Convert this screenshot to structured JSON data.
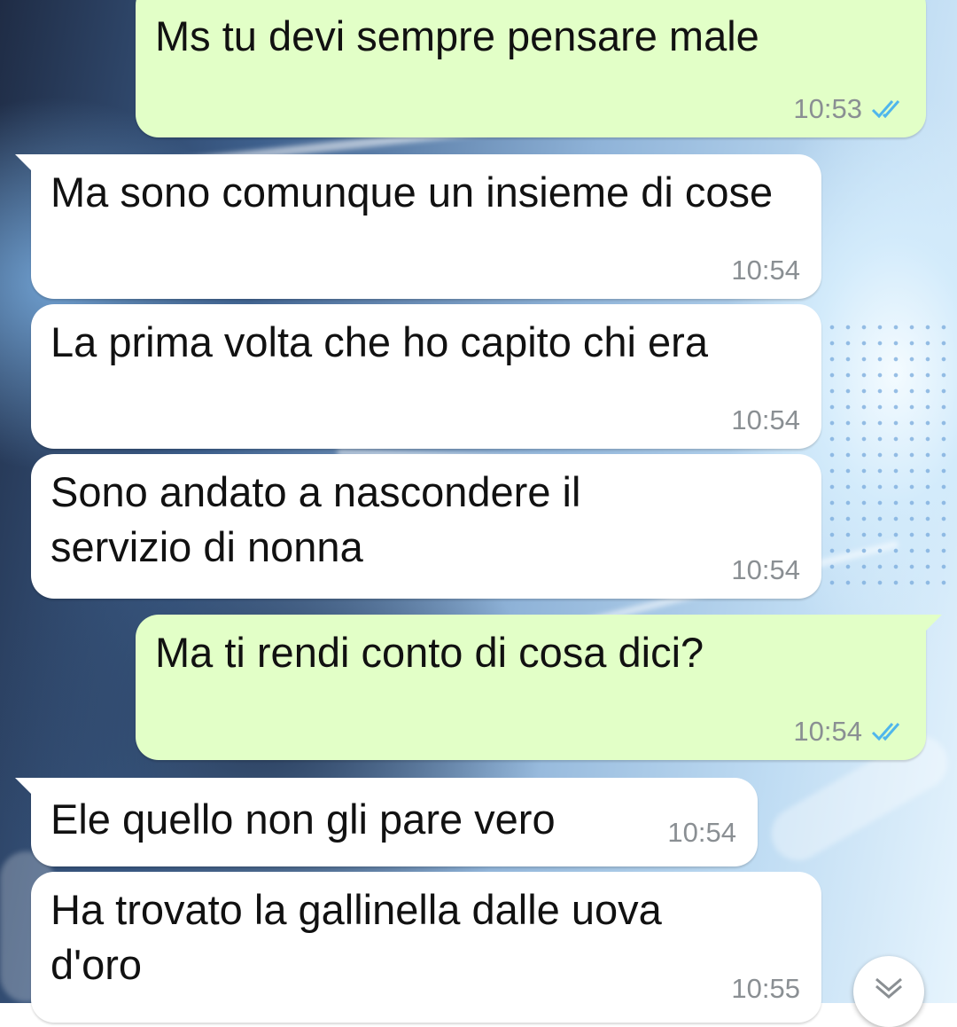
{
  "chat": {
    "messages": [
      {
        "direction": "out",
        "text": "Ms tu devi sempre pensare male",
        "time": "10:53",
        "status": "read"
      },
      {
        "direction": "in",
        "text": "Ma sono comunque un insieme di cose",
        "time": "10:54"
      },
      {
        "direction": "in",
        "text": "La prima volta che ho capito chi era",
        "time": "10:54"
      },
      {
        "direction": "in",
        "text": "Sono andato a nascondere il servizio di nonna",
        "time": "10:54"
      },
      {
        "direction": "out",
        "text": "Ma ti rendi conto di cosa dici?",
        "time": "10:54",
        "status": "read"
      },
      {
        "direction": "in",
        "text": "Ele quello non gli pare vero",
        "time": "10:54"
      },
      {
        "direction": "in",
        "text": "Ha trovato la gallinella dalle uova d'oro",
        "time": "10:55"
      }
    ]
  },
  "icons": {
    "read_receipt": "double-check-icon",
    "scroll_down": "chevron-double-down-icon"
  },
  "colors": {
    "outgoing_bubble": "#e2ffc7",
    "incoming_bubble": "#ffffff",
    "read_tick": "#4fb6ec",
    "timestamp": "#8a8f93"
  }
}
